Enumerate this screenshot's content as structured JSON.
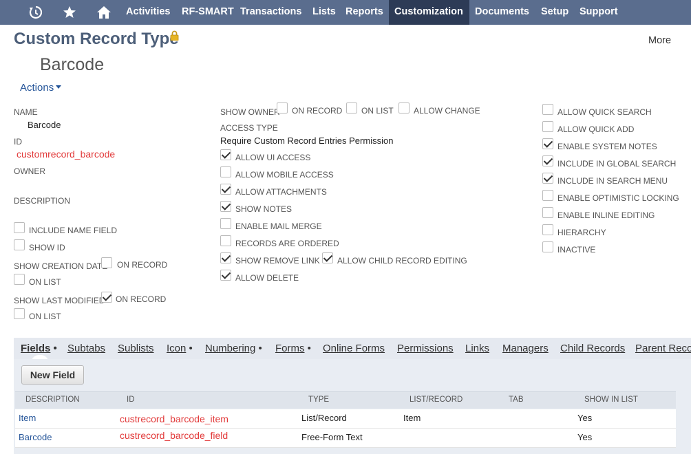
{
  "nav": {
    "items": [
      "Activities",
      "RF-SMART",
      "Transactions",
      "Lists",
      "Reports",
      "Customization",
      "Documents",
      "Setup",
      "Support"
    ],
    "active": "Customization",
    "icons": [
      "recent-history-icon",
      "star-icon",
      "home-icon"
    ]
  },
  "header": {
    "title": "Custom Record Type",
    "record_name": "Barcode",
    "more": "More",
    "actions": "Actions"
  },
  "left": {
    "name_label": "NAME",
    "name_value": "Barcode",
    "id_label": "ID",
    "id_value": "customrecord_barcode",
    "owner_label": "OWNER",
    "description_label": "DESCRIPTION",
    "include_name_field": "INCLUDE NAME FIELD",
    "show_id": "SHOW ID",
    "show_creation_date": "SHOW CREATION DATE",
    "show_last_modified": "SHOW LAST MODIFIED",
    "on_record": "ON RECORD",
    "on_list": "ON LIST"
  },
  "middle": {
    "show_owner": "SHOW OWNER",
    "on_record": "ON RECORD",
    "on_list": "ON LIST",
    "allow_change": "ALLOW CHANGE",
    "access_type_label": "ACCESS TYPE",
    "access_type_value": "Require Custom Record Entries Permission",
    "allow_ui_access": "ALLOW UI ACCESS",
    "allow_mobile_access": "ALLOW MOBILE ACCESS",
    "allow_attachments": "ALLOW ATTACHMENTS",
    "show_notes": "SHOW NOTES",
    "enable_mail_merge": "ENABLE MAIL MERGE",
    "records_are_ordered": "RECORDS ARE ORDERED",
    "show_remove_link": "SHOW REMOVE LINK",
    "allow_child_record_editing": "ALLOW CHILD RECORD EDITING",
    "allow_delete": "ALLOW DELETE"
  },
  "right": {
    "allow_quick_search": "ALLOW QUICK SEARCH",
    "allow_quick_add": "ALLOW QUICK ADD",
    "enable_system_notes": "ENABLE SYSTEM NOTES",
    "include_in_global_search": "INCLUDE IN GLOBAL SEARCH",
    "include_in_search_menu": "INCLUDE IN SEARCH MENU",
    "enable_optimistic_locking": "ENABLE OPTIMISTIC LOCKING",
    "enable_inline_editing": "ENABLE INLINE EDITING",
    "hierarchy": "HIERARCHY",
    "inactive": "INACTIVE"
  },
  "tabs": {
    "fields": "Fields",
    "subtabs": "Subtabs",
    "sublists": "Sublists",
    "icon": "Icon",
    "numbering": "Numbering",
    "forms": "Forms",
    "online_forms": "Online Forms",
    "permissions": "Permissions",
    "links": "Links",
    "managers": "Managers",
    "child_records": "Child Records",
    "parent_records": "Parent Recor",
    "bullet": "•"
  },
  "fields_tab": {
    "new_field": "New Field",
    "columns": [
      "DESCRIPTION",
      "ID",
      "TYPE",
      "LIST/RECORD",
      "TAB",
      "SHOW IN LIST"
    ],
    "rows": [
      {
        "description": "Item",
        "id": "custrecord_barcode_item",
        "type": "List/Record",
        "list_record": "Item",
        "tab": "",
        "show_in_list": "Yes"
      },
      {
        "description": "Barcode",
        "id": "custrecord_barcode_field",
        "type": "Free-Form Text",
        "list_record": "",
        "tab": "",
        "show_in_list": "Yes"
      }
    ]
  },
  "colors": {
    "nav_bg": "#5a6d8e",
    "nav_active": "#2d3b56",
    "title": "#4d5f79",
    "link": "#255599",
    "highlight_red": "#e23a3a"
  }
}
